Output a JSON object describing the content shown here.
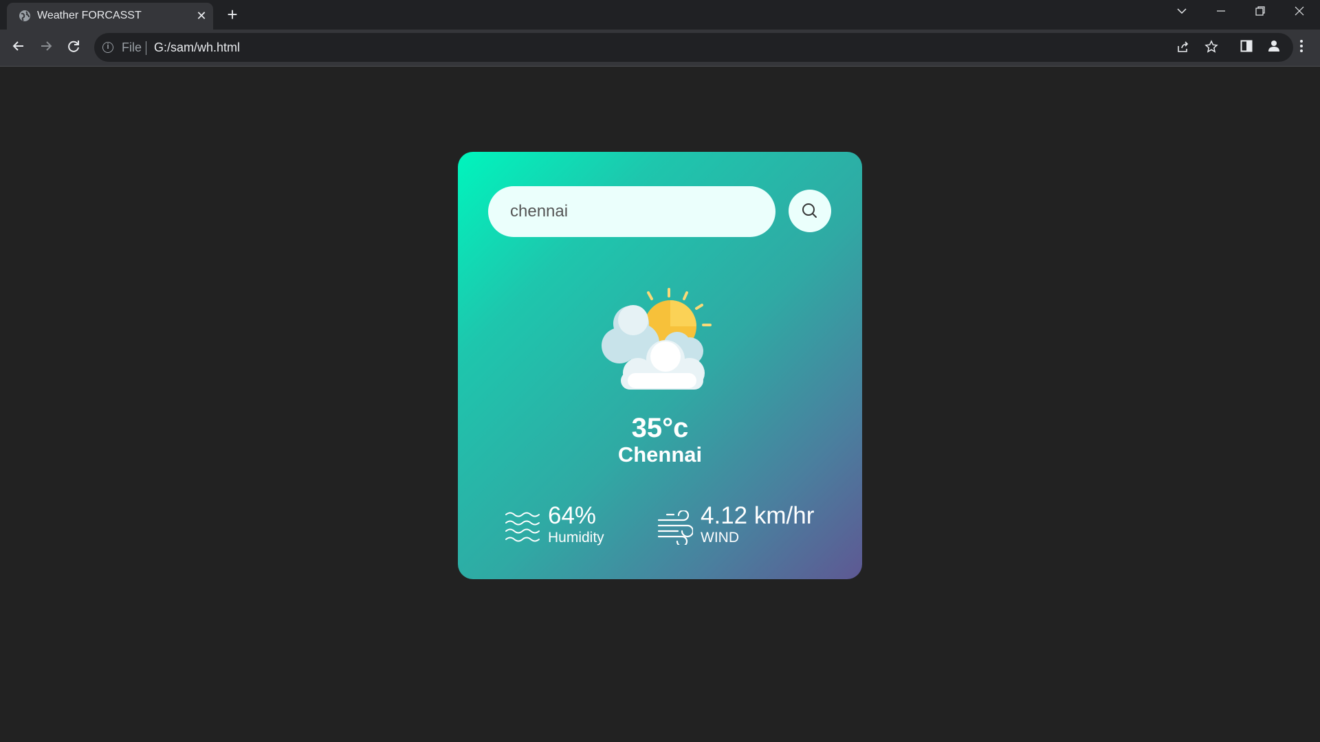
{
  "browser": {
    "tab_title": "Weather FORCASST",
    "tab_close": "✕",
    "new_tab": "+",
    "omnibox_scheme": "File",
    "url": "G:/sam/wh.html"
  },
  "weather": {
    "search_value": "chennai",
    "temperature": "35°c",
    "city": "Chennai",
    "humidity_value": "64%",
    "humidity_label": "Humidity",
    "wind_value": "4.12 km/hr",
    "wind_label": "WIND",
    "condition_icon": "partly-cloudy-icon"
  },
  "colors": {
    "gradient_start": "#00f5bd",
    "gradient_end": "#5e5893",
    "page_background": "#222222"
  }
}
